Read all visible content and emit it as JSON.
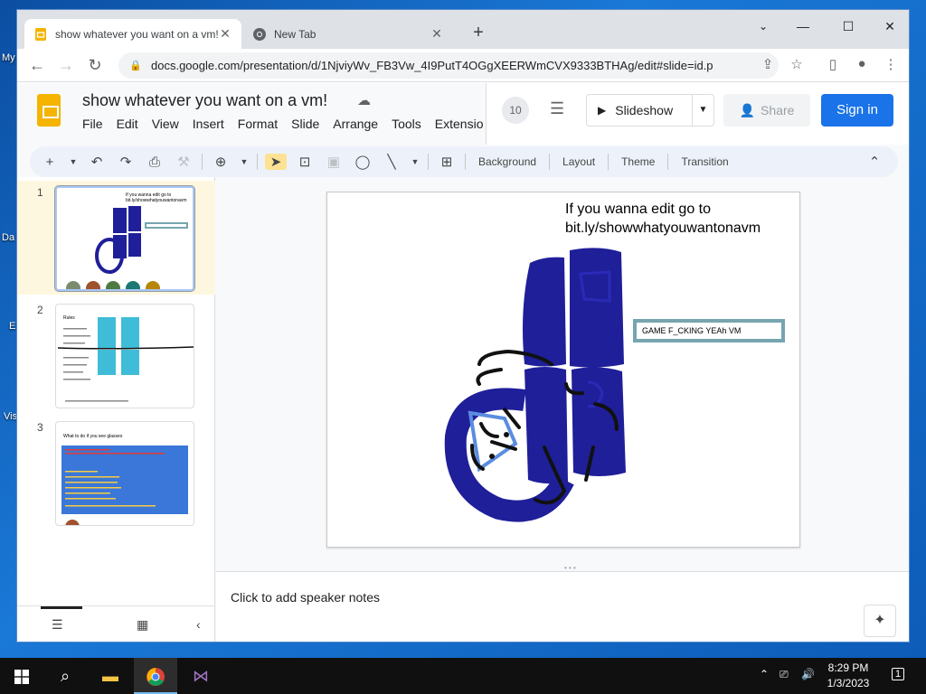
{
  "desktop": {
    "labels": [
      "My",
      "Da",
      "E",
      "Vis"
    ]
  },
  "browser": {
    "tabs": [
      {
        "title": "show whatever you want on a vm!",
        "active": true
      },
      {
        "title": "New Tab",
        "active": false
      }
    ],
    "url": "docs.google.com/presentation/d/1NjviyWv_FB3Vw_4I9PutT4OGgXEERWmCVX9333BTHAg/edit#slide=id.p"
  },
  "slides_app": {
    "doc_title": "show whatever you want on a vm!",
    "menu": [
      "File",
      "Edit",
      "View",
      "Insert",
      "Format",
      "Slide",
      "Arrange",
      "Tools",
      "Extensio"
    ],
    "version_count": "10",
    "slideshow_label": "Slideshow",
    "share_label": "Share",
    "signin_label": "Sign in",
    "toolbar_text_buttons": {
      "background": "Background",
      "layout": "Layout",
      "theme": "Theme",
      "transition": "Transition"
    },
    "slide_numbers": [
      "1",
      "2",
      "3"
    ],
    "thumbs": {
      "slide1_text": "If you wanna edit go to bit.ly/showwhatyouwantonavm",
      "slide2_title": "Rules",
      "slide3_title": "What to do if you see glasses"
    },
    "current_slide": {
      "text_line1": "If you wanna edit go to",
      "text_line2": "bit.ly/showwhatyouwantonavm",
      "box_text": "GAME F_CKING YEAh VM"
    },
    "speaker_notes_placeholder": "Click to add speaker notes"
  },
  "taskbar": {
    "time": "8:29 PM",
    "date": "1/3/2023",
    "notification_count": "1"
  },
  "colors": {
    "accent_blue": "#1a73e8",
    "slides_yellow": "#f4b400",
    "drawing_navy": "#1f1f9a",
    "box_border": "#76a5af"
  }
}
